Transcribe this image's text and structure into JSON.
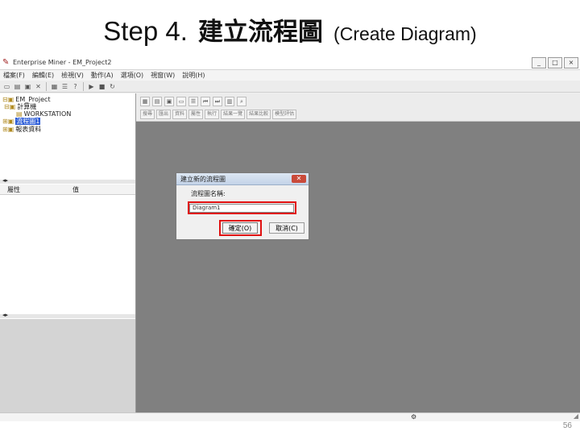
{
  "slide": {
    "title_step": "Step 4.",
    "title_cjk": "建立流程圖",
    "title_en": "(Create Diagram)",
    "page_number": "56"
  },
  "window": {
    "title": "Enterprise Miner - EM_Project2",
    "controls": [
      "_",
      "□",
      "×"
    ]
  },
  "menu": [
    "檔案(F)",
    "編輯(E)",
    "檢視(V)",
    "動作(A)",
    "選項(O)",
    "視窗(W)",
    "說明(H)"
  ],
  "tree": {
    "items": [
      {
        "label": "EM_Project",
        "level": 0,
        "icon": "folder-icon"
      },
      {
        "label": "計算機",
        "level": 1,
        "icon": "computer-icon"
      },
      {
        "label": "WORKSTATION",
        "level": 2,
        "icon": "workstation-icon"
      },
      {
        "label": "流程圖1",
        "level": 0,
        "icon": "diagram-icon",
        "selected": true
      },
      {
        "label": "報表資料",
        "level": 0,
        "icon": "report-icon"
      }
    ]
  },
  "properties": {
    "col_property": "屬性",
    "col_value": "值"
  },
  "workspace": {
    "tools": [
      "搜尋",
      "匯出",
      "資料",
      "屬性",
      "執行",
      "結果一覽",
      "結果比較",
      "模型評估"
    ]
  },
  "dialog": {
    "title": "建立新的流程圖",
    "label": "流程圖名稱:",
    "input_value": "Diagram1",
    "ok_label": "確定(O)",
    "cancel_label": "取消(C)",
    "highlight_color": "#e01010"
  }
}
